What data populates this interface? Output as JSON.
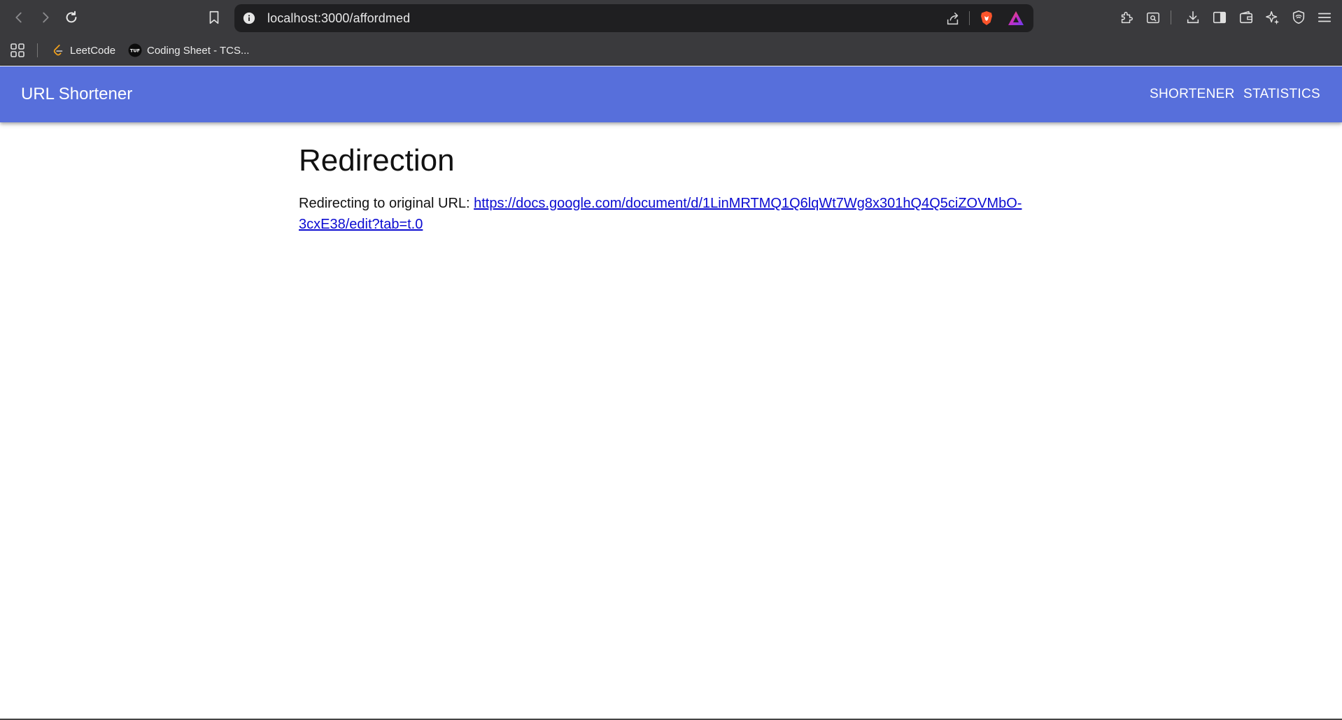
{
  "browser": {
    "address_url": "localhost:3000/affordmed",
    "bookmarks": [
      {
        "label": "LeetCode",
        "icon": "leetcode-icon"
      },
      {
        "label": "Coding Sheet - TCS...",
        "icon": "tuf-icon"
      }
    ],
    "tuf_badge": "TUF"
  },
  "app": {
    "title": "URL Shortener",
    "nav": {
      "shortener": "SHORTENER",
      "statistics": "STATISTICS"
    }
  },
  "page": {
    "heading": "Redirection",
    "redirect_prefix": "Redirecting to original URL: ",
    "original_url": "https://docs.google.com/document/d/1LinMRTMQ1Q6lqWt7Wg8x301hQ4Q5ciZOVMbO-3cxE38/edit?tab=t.0"
  },
  "colors": {
    "appbar": "#576fdb",
    "browser_chrome": "#3a3a3d",
    "link": "#0b0bd1"
  }
}
